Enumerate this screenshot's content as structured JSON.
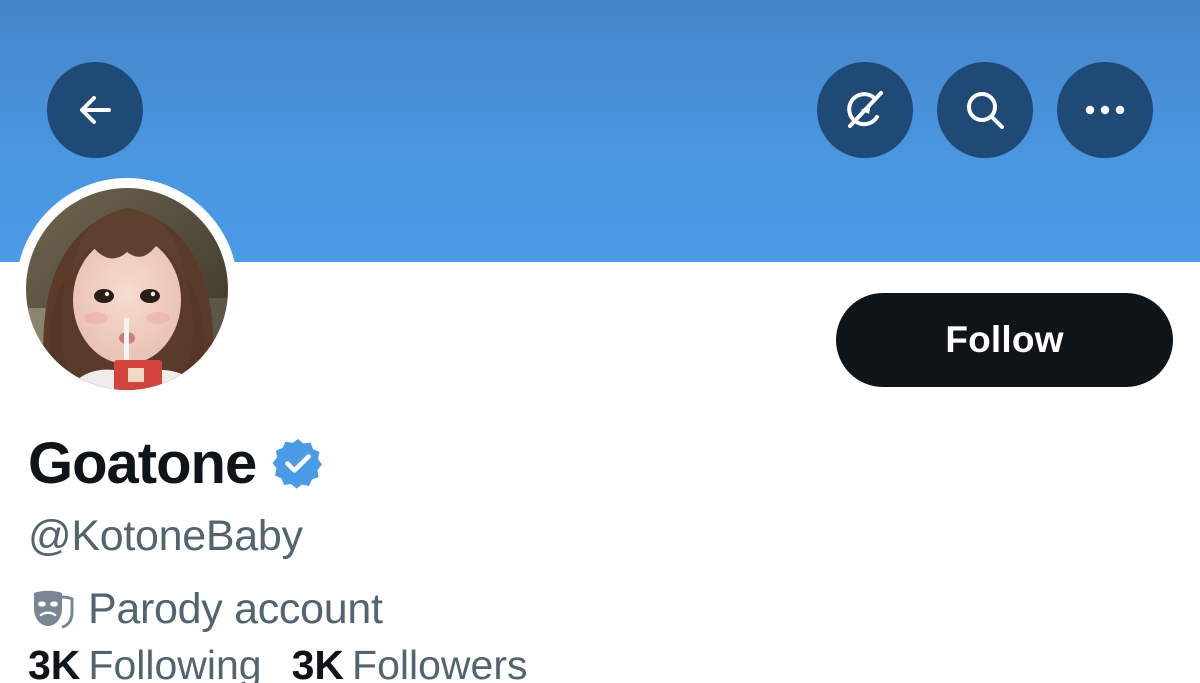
{
  "header": {
    "back_icon": "arrow-left-icon",
    "grok_icon": "grok-icon",
    "search_icon": "search-icon",
    "more_icon": "more-horizontal-icon",
    "banner_color": "#4a96e0",
    "button_color": "#1f4a76"
  },
  "profile": {
    "follow_label": "Follow",
    "display_name": "Goatone",
    "verified_icon": "verified-badge-icon",
    "verified_color": "#4a9be6",
    "handle": "@KotoneBaby",
    "parody_icon": "theater-masks-icon",
    "parody_label": "Parody account",
    "following_count": "3K",
    "following_label": "Following",
    "followers_count": "3K",
    "followers_label": "Followers"
  }
}
